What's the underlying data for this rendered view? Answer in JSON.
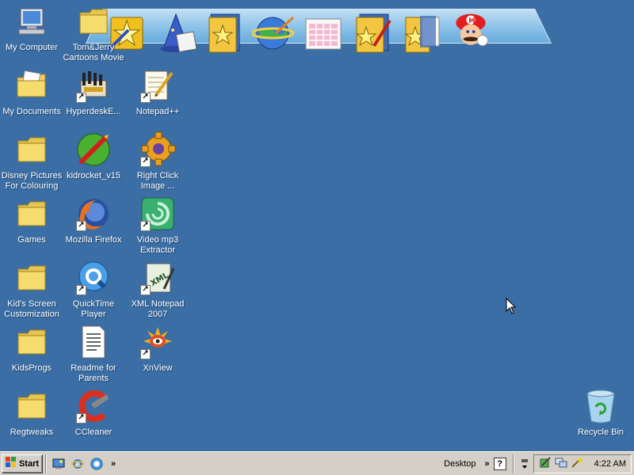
{
  "desktop": {
    "background": "#3a6ea5",
    "icons": [
      {
        "label": "My Computer"
      },
      {
        "label": "Tom&Jerry Cartoons Movie"
      },
      {
        "label": "My Documents"
      },
      {
        "label": "HyperdeskE..."
      },
      {
        "label": "Notepad++"
      },
      {
        "label": "Disney Pictures For Colouring"
      },
      {
        "label": "kidrocket_v15"
      },
      {
        "label": "Right Click Image ..."
      },
      {
        "label": "Games"
      },
      {
        "label": "Mozilla Firefox"
      },
      {
        "label": "Video mp3 Extractor"
      },
      {
        "label": "Kid's Screen Customization"
      },
      {
        "label": "QuickTime Player"
      },
      {
        "label": "XML Notepad 2007"
      },
      {
        "label": "KidsProgs"
      },
      {
        "label": "Readme for Parents"
      },
      {
        "label": "XnView"
      },
      {
        "label": "Regtweaks"
      },
      {
        "label": "CCleaner"
      },
      {
        "label": "Recycle Bin"
      }
    ]
  },
  "dock": {
    "items": [
      "magic-wand-icon",
      "wizard-hat-icon",
      "star-folder-icon",
      "globe-wand-icon",
      "calendar-grid-icon",
      "paint-folder-icon",
      "document-folder-icon",
      "mario-icon"
    ]
  },
  "taskbar": {
    "start_label": "Start",
    "toolbar_label": "Desktop",
    "overflow": "»",
    "clock": "4:22 AM"
  }
}
